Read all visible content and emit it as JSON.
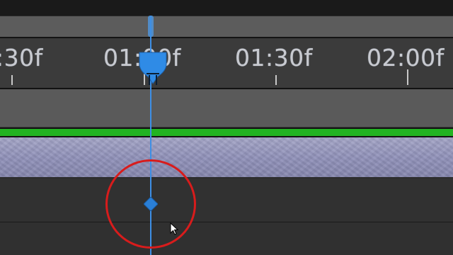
{
  "timeline": {
    "ruler_labels": [
      ":30f",
      "01:00f",
      "01:30f",
      "02:00f"
    ]
  },
  "icons": {
    "playhead": "current-time-indicator",
    "keyframe": "keyframe-diamond",
    "cursor": "mouse-pointer-arrow"
  },
  "colors": {
    "playhead": "#3d8fe6",
    "keyframe": "#2a7fd6",
    "layer_bar": "#9798bd",
    "green_bar": "#22b322",
    "highlight": "#d81c1c"
  }
}
